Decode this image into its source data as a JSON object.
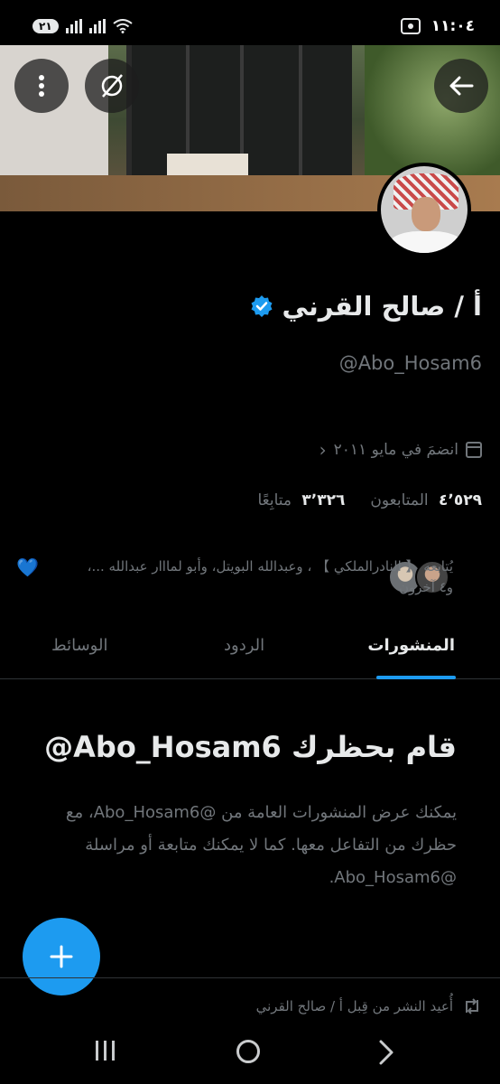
{
  "status_bar": {
    "sim_badge": "٢١",
    "time": "١١:٠٤"
  },
  "profile": {
    "display_name": "أ / صالح القرني",
    "handle": "@Abo_Hosam6",
    "joined": "انضمَ في مايو ٢٠١١",
    "stats": {
      "followers_count": "٤٬٥٢٩",
      "followers_label": "المتابعون",
      "following_count": "٣٬٣٢٦",
      "following_label": "متابِعًا"
    },
    "known_followers_text": "يُتابعه 【 النادرالملكي 】 ، وعبدالله البويتل، وأبو لمااار عبدالله ...، و٤ آخرون",
    "known_followers_heart": "💙"
  },
  "tabs": [
    {
      "label": "المنشورات",
      "active": true
    },
    {
      "label": "الردود",
      "active": false
    },
    {
      "label": "الوسائط",
      "active": false
    }
  ],
  "blocked": {
    "title": "@Abo_Hosam6 قام بحظرك",
    "body": "يمكنك عرض المنشورات العامة من @Abo_Hosam6، مع حظرك من التفاعل معها. كما لا يمكنك متابعة أو مراسلة @Abo_Hosam6."
  },
  "repost_row": {
    "text": "أُعيد النشر من قِبل أ / صالح القرني"
  },
  "colors": {
    "accent": "#1d9bf0",
    "background": "#000000",
    "muted_text": "#71767b",
    "primary_text": "#e7e9ea"
  },
  "icons": {
    "back": "arrow-left-icon",
    "more": "more-vertical-icon",
    "grok": "grok-icon",
    "verified": "verified-badge-icon",
    "calendar": "calendar-icon",
    "compose": "plus-icon",
    "repost": "repost-icon"
  }
}
